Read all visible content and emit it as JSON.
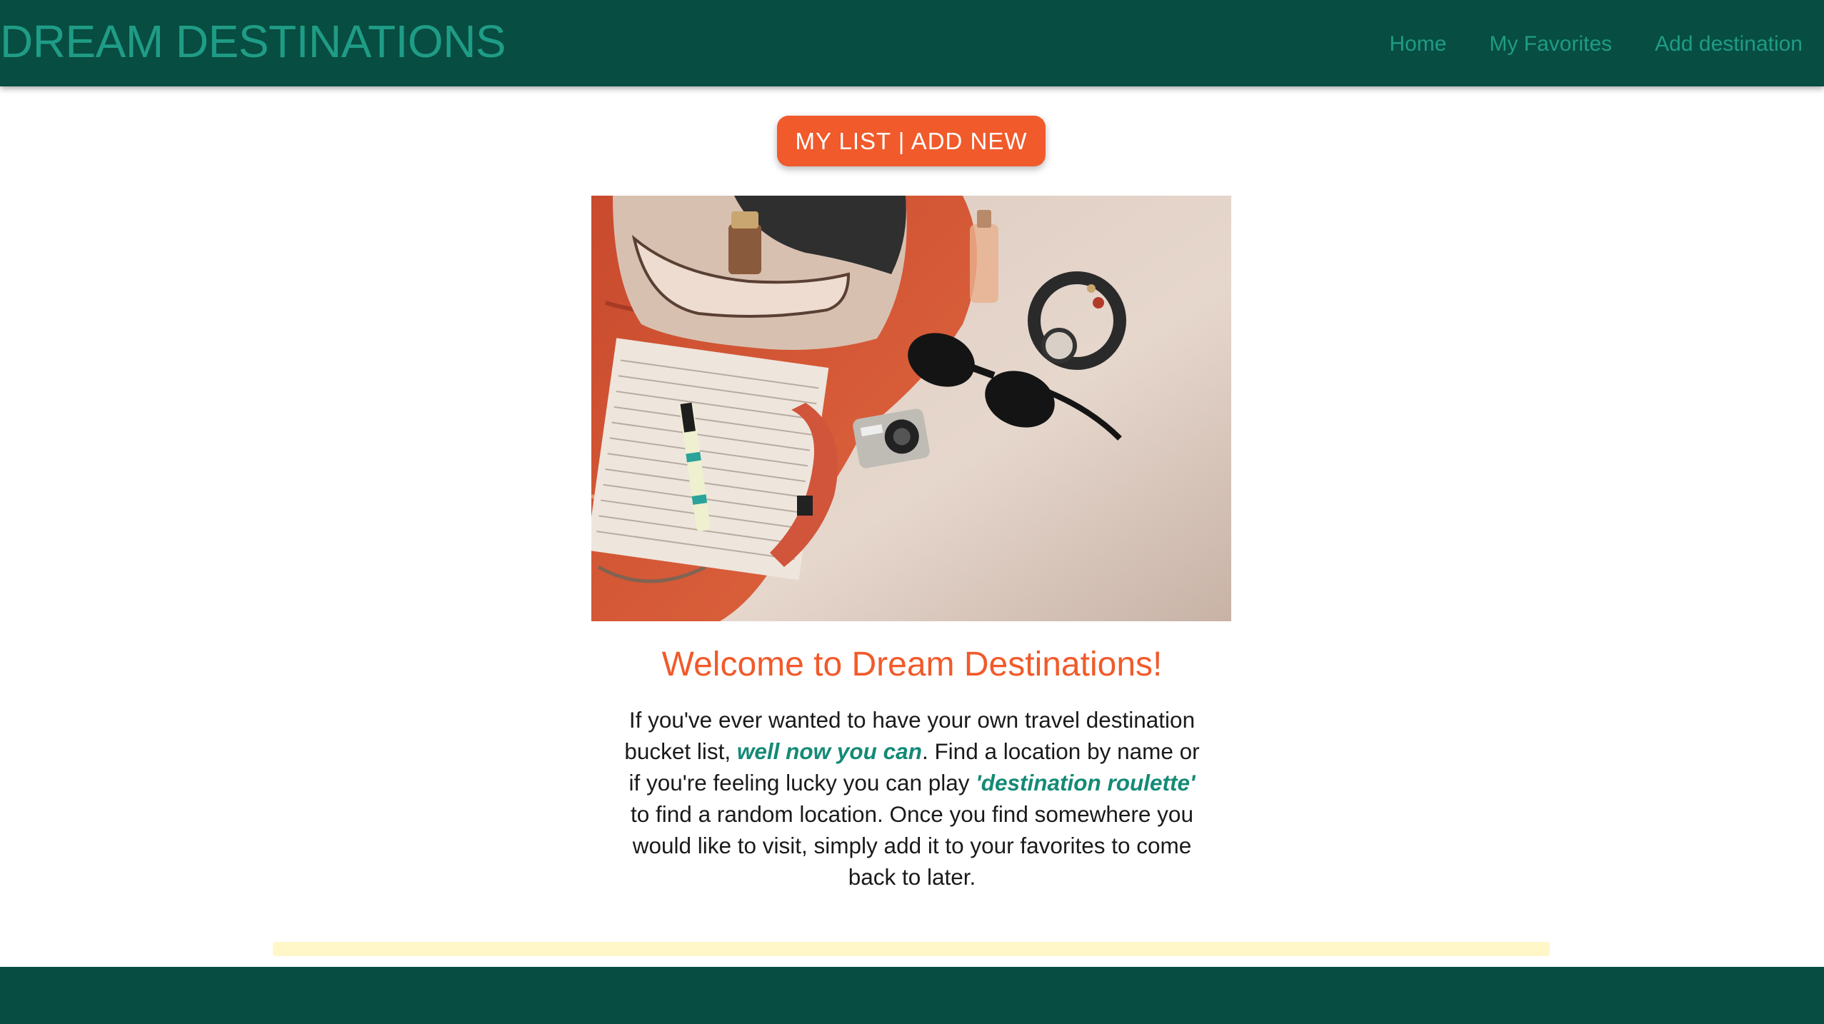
{
  "navbar": {
    "brand": "DREAM DESTINATIONS",
    "links": [
      {
        "label": "Home"
      },
      {
        "label": "My Favorites"
      },
      {
        "label": "Add destination"
      }
    ]
  },
  "cta": {
    "label": "MY LIST | ADD NEW"
  },
  "hero": {
    "image": "travel-flatlay-photo"
  },
  "welcome": {
    "title": "Welcome to Dream Destinations!",
    "p1": "If you've ever wanted to have your own travel destination bucket list, ",
    "highlight1": "well now you can",
    "p2": ". Find a location by name or if you're feeling lucky you can play ",
    "highlight2": "'destination roulette'",
    "p3": " to find a random location. Once you find somewhere you would like to visit, simply add it to your favorites to come back to later."
  },
  "colors": {
    "navbar_bg": "#074d41",
    "brand": "#1f9c86",
    "accent": "#f15a2b",
    "highlight": "#148a76",
    "strip": "#fff7c8"
  }
}
